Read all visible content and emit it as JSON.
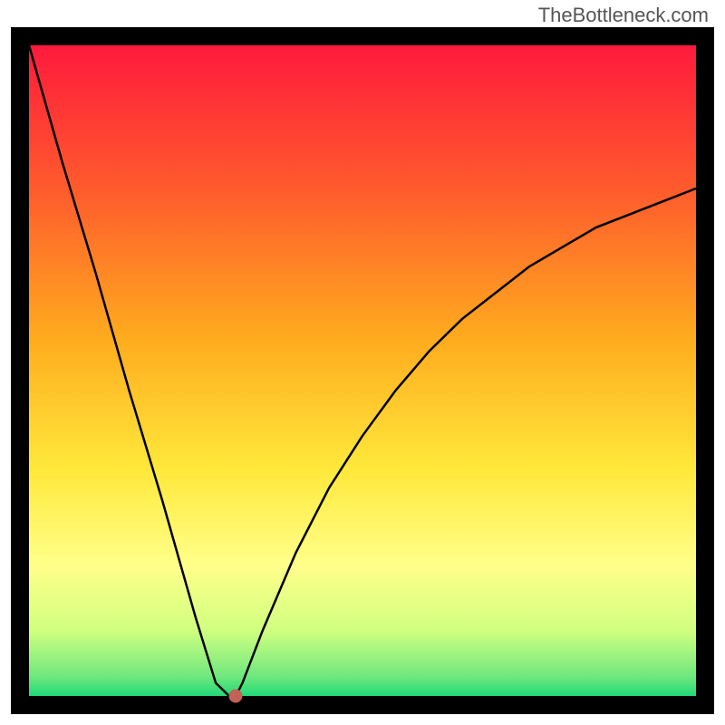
{
  "watermark": "TheBottleneck.com",
  "chart_data": {
    "type": "line",
    "title": "",
    "xlabel": "",
    "ylabel": "",
    "xlim": [
      0,
      100
    ],
    "ylim": [
      0,
      100
    ],
    "x": [
      0,
      5,
      10,
      15,
      20,
      25,
      28,
      30,
      31,
      32,
      35,
      40,
      45,
      50,
      55,
      60,
      65,
      70,
      75,
      80,
      85,
      90,
      95,
      100
    ],
    "values": [
      100,
      82,
      65,
      47,
      30,
      12,
      2,
      0,
      0,
      2,
      10,
      22,
      32,
      40,
      47,
      53,
      58,
      62,
      66,
      69,
      72,
      74,
      76,
      78
    ],
    "marker": {
      "x": 31,
      "y": 0
    },
    "background_gradient": [
      "#ff1a3c",
      "#ff6a2a",
      "#ffbb1f",
      "#ffe83a",
      "#ffff8a",
      "#d0ff80",
      "#2fe27a"
    ]
  },
  "gradient_stops": [
    {
      "offset": "0%",
      "color": "#ff1a3c"
    },
    {
      "offset": "22%",
      "color": "#ff5a2d"
    },
    {
      "offset": "45%",
      "color": "#ffab1e"
    },
    {
      "offset": "65%",
      "color": "#ffe83a"
    },
    {
      "offset": "80%",
      "color": "#ffff8a"
    },
    {
      "offset": "90%",
      "color": "#d0ff80"
    },
    {
      "offset": "97%",
      "color": "#6fe87f"
    },
    {
      "offset": "100%",
      "color": "#20d878"
    }
  ]
}
